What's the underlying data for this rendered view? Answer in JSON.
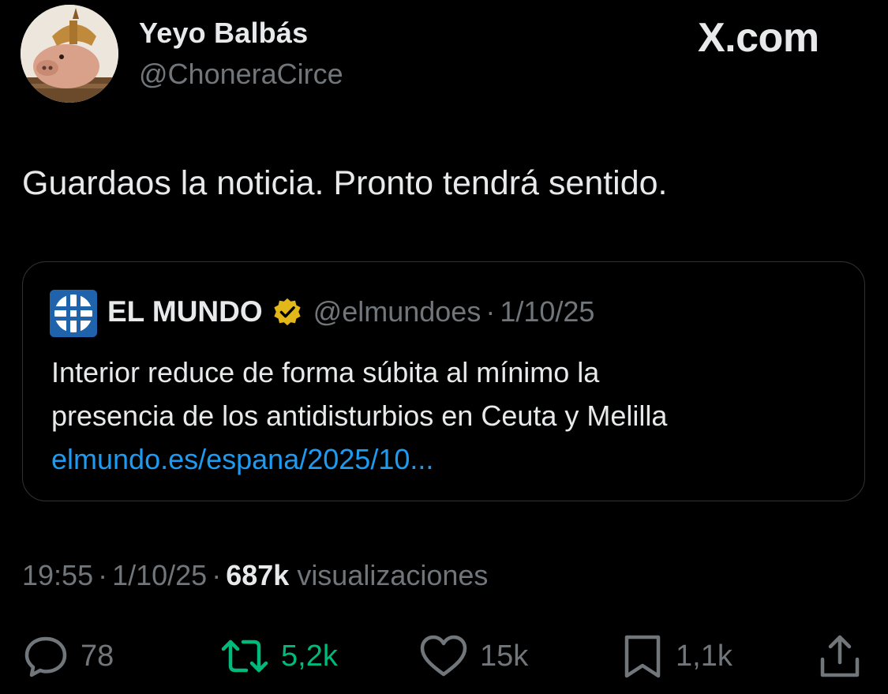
{
  "author": {
    "name": "Yeyo Balbás",
    "handle": "@ChoneraCirce"
  },
  "brand": "X.com",
  "tweet_text": "Guardaos la noticia. Pronto tendrá sentido.",
  "quote": {
    "name": "EL MUNDO",
    "handle": "@elmundoes",
    "separator": "·",
    "date": "1/10/25",
    "text_line1": "Interior reduce de forma súbita al mínimo la",
    "text_line2": "presencia de los antidisturbios en Ceuta y Melilla",
    "link": "elmundo.es/espana/2025/10..."
  },
  "meta": {
    "time": "19:55",
    "separator": "·",
    "date": "1/10/25",
    "views_count": "687k",
    "views_label": "visualizaciones"
  },
  "actions": {
    "replies": "78",
    "retweets": "5,2k",
    "likes": "15k",
    "bookmarks": "1,1k"
  },
  "colors": {
    "background": "#000000",
    "text": "#e7e9ea",
    "secondary": "#71767b",
    "link": "#1d9bf0",
    "retweet": "#00ba7c",
    "verified": "#e2b719"
  }
}
